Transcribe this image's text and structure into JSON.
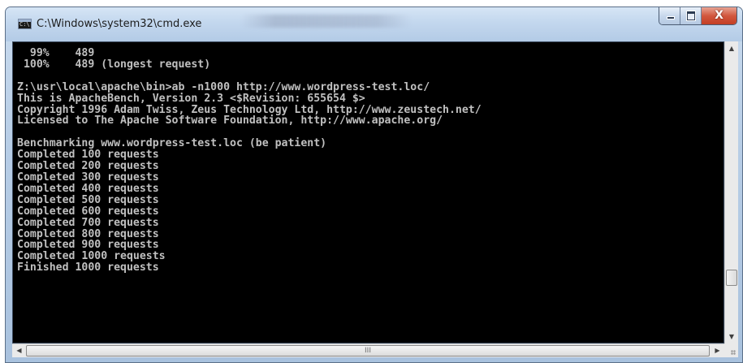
{
  "window": {
    "title": "C:\\Windows\\system32\\cmd.exe",
    "app_icon": "cmd-icon",
    "app_icon_text": "C:\\",
    "buttons": {
      "minimize_icon": "minimize-icon",
      "maximize_icon": "maximize-icon",
      "close_icon": "close-icon",
      "close_glyph": "X"
    }
  },
  "console": {
    "background": "#000000",
    "foreground": "#c0c0c0",
    "lines": [
      "  99%    489",
      " 100%    489 (longest request)",
      "",
      "Z:\\usr\\local\\apache\\bin>ab -n1000 http://www.wordpress-test.loc/",
      "This is ApacheBench, Version 2.3 <$Revision: 655654 $>",
      "Copyright 1996 Adam Twiss, Zeus Technology Ltd, http://www.zeustech.net/",
      "Licensed to The Apache Software Foundation, http://www.apache.org/",
      "",
      "Benchmarking www.wordpress-test.loc (be patient)",
      "Completed 100 requests",
      "Completed 200 requests",
      "Completed 300 requests",
      "Completed 400 requests",
      "Completed 500 requests",
      "Completed 600 requests",
      "Completed 700 requests",
      "Completed 800 requests",
      "Completed 900 requests",
      "Completed 1000 requests",
      "Finished 1000 requests"
    ]
  },
  "scrollbars": {
    "vertical": {
      "up_glyph": "▲",
      "down_glyph": "▼"
    },
    "horizontal": {
      "left_glyph": "◀",
      "right_glyph": "▶",
      "grip": "III"
    }
  }
}
